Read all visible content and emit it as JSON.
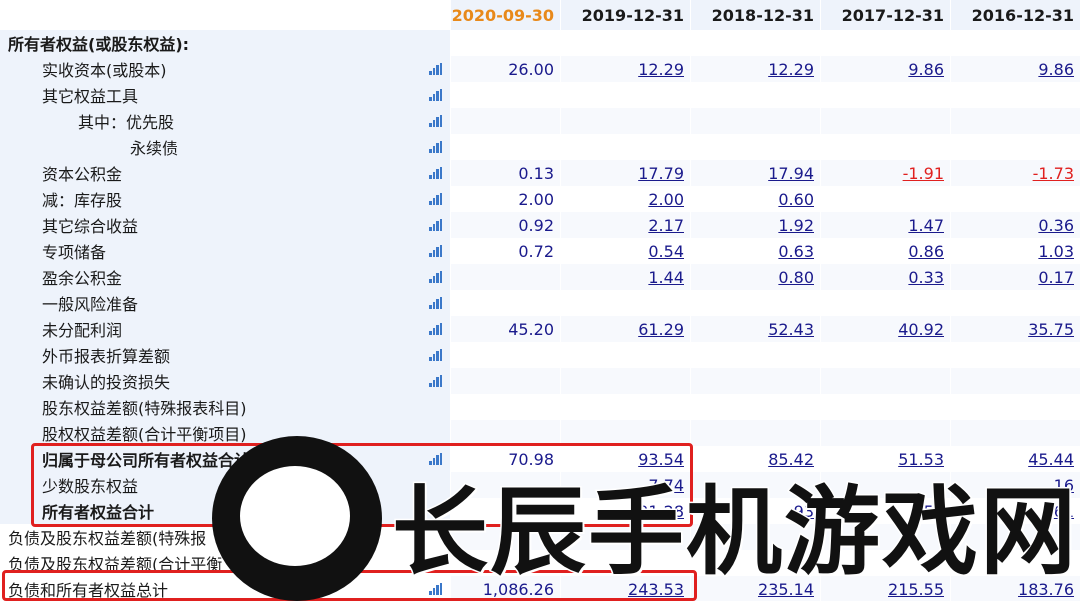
{
  "header": {
    "dates": [
      "2020-09-30",
      "2019-12-31",
      "2018-12-31",
      "2017-12-31",
      "2016-12-31"
    ]
  },
  "rows": [
    {
      "label": "所有者权益(或股东权益):",
      "indent": 0,
      "bold": true,
      "icon": false,
      "values": [
        "",
        "",
        "",
        "",
        ""
      ]
    },
    {
      "label": "实收资本(或股本)",
      "indent": 1,
      "bold": false,
      "icon": true,
      "values": [
        "26.00",
        "12.29",
        "12.29",
        "9.86",
        "9.86"
      ]
    },
    {
      "label": "其它权益工具",
      "indent": 1,
      "bold": false,
      "icon": true,
      "values": [
        "",
        "",
        "",
        "",
        ""
      ]
    },
    {
      "label": "其中：优先股",
      "indent": 2,
      "bold": false,
      "icon": true,
      "values": [
        "",
        "",
        "",
        "",
        ""
      ]
    },
    {
      "label": "永续债",
      "indent": 3,
      "bold": false,
      "icon": true,
      "values": [
        "",
        "",
        "",
        "",
        ""
      ]
    },
    {
      "label": "资本公积金",
      "indent": 1,
      "bold": false,
      "icon": true,
      "values": [
        "0.13",
        "17.79",
        "17.94",
        "-1.91",
        "-1.73"
      ]
    },
    {
      "label": "减：库存股",
      "indent": 1,
      "bold": false,
      "icon": true,
      "values": [
        "2.00",
        "2.00",
        "0.60",
        "",
        ""
      ]
    },
    {
      "label": "其它综合收益",
      "indent": 1,
      "bold": false,
      "icon": true,
      "values": [
        "0.92",
        "2.17",
        "1.92",
        "1.47",
        "0.36"
      ]
    },
    {
      "label": "专项储备",
      "indent": 1,
      "bold": false,
      "icon": true,
      "values": [
        "0.72",
        "0.54",
        "0.63",
        "0.86",
        "1.03"
      ]
    },
    {
      "label": "盈余公积金",
      "indent": 1,
      "bold": false,
      "icon": true,
      "values": [
        "",
        "1.44",
        "0.80",
        "0.33",
        "0.17"
      ]
    },
    {
      "label": "一般风险准备",
      "indent": 1,
      "bold": false,
      "icon": true,
      "values": [
        "",
        "",
        "",
        "",
        ""
      ]
    },
    {
      "label": "未分配利润",
      "indent": 1,
      "bold": false,
      "icon": true,
      "values": [
        "45.20",
        "61.29",
        "52.43",
        "40.92",
        "35.75"
      ]
    },
    {
      "label": "外币报表折算差额",
      "indent": 1,
      "bold": false,
      "icon": true,
      "values": [
        "",
        "",
        "",
        "",
        ""
      ]
    },
    {
      "label": "未确认的投资损失",
      "indent": 1,
      "bold": false,
      "icon": true,
      "values": [
        "",
        "",
        "",
        "",
        ""
      ]
    },
    {
      "label": "股东权益差额(特殊报表科目)",
      "indent": 1,
      "bold": false,
      "icon": false,
      "values": [
        "",
        "",
        "",
        "",
        ""
      ]
    },
    {
      "label": "股权权益差额(合计平衡项目)",
      "indent": 1,
      "bold": false,
      "icon": false,
      "values": [
        "",
        "",
        "",
        "",
        ""
      ]
    },
    {
      "label": "归属于母公司所有者权益合计",
      "indent": 1,
      "bold": true,
      "icon": true,
      "values": [
        "70.98",
        "93.54",
        "85.42",
        "51.53",
        "45.44"
      ]
    },
    {
      "label": "少数股东权益",
      "indent": 1,
      "bold": false,
      "icon": false,
      "values": [
        "",
        "7.74",
        "",
        "",
        "16"
      ]
    },
    {
      "label": "所有者权益合计",
      "indent": 1,
      "bold": true,
      "icon": false,
      "values": [
        "",
        "101.28",
        "93",
        "59",
        "61"
      ]
    },
    {
      "label": "负债及股东权益差额(特殊报",
      "indent": 0,
      "bold": false,
      "icon": false,
      "values": [
        "",
        "",
        "",
        "",
        ""
      ]
    },
    {
      "label": "负债及股东权益差额(合计平衡",
      "indent": 0,
      "bold": false,
      "icon": false,
      "values": [
        "",
        "",
        "",
        "",
        ""
      ]
    },
    {
      "label": "负债和所有者权益总计",
      "indent": 0,
      "bold": false,
      "icon": true,
      "values": [
        "1,086.26",
        "243.53",
        "235.14",
        "215.55",
        "183.76"
      ]
    }
  ],
  "watermark": {
    "text": "长辰手机游戏网"
  },
  "colors": {
    "accent_date": "#e8891a",
    "value_text": "#1a1a8c",
    "negative": "#e0201f",
    "highlight_box": "#e0201f",
    "label_bg": "#eef3fb",
    "icon_blue": "#3b78c9"
  }
}
